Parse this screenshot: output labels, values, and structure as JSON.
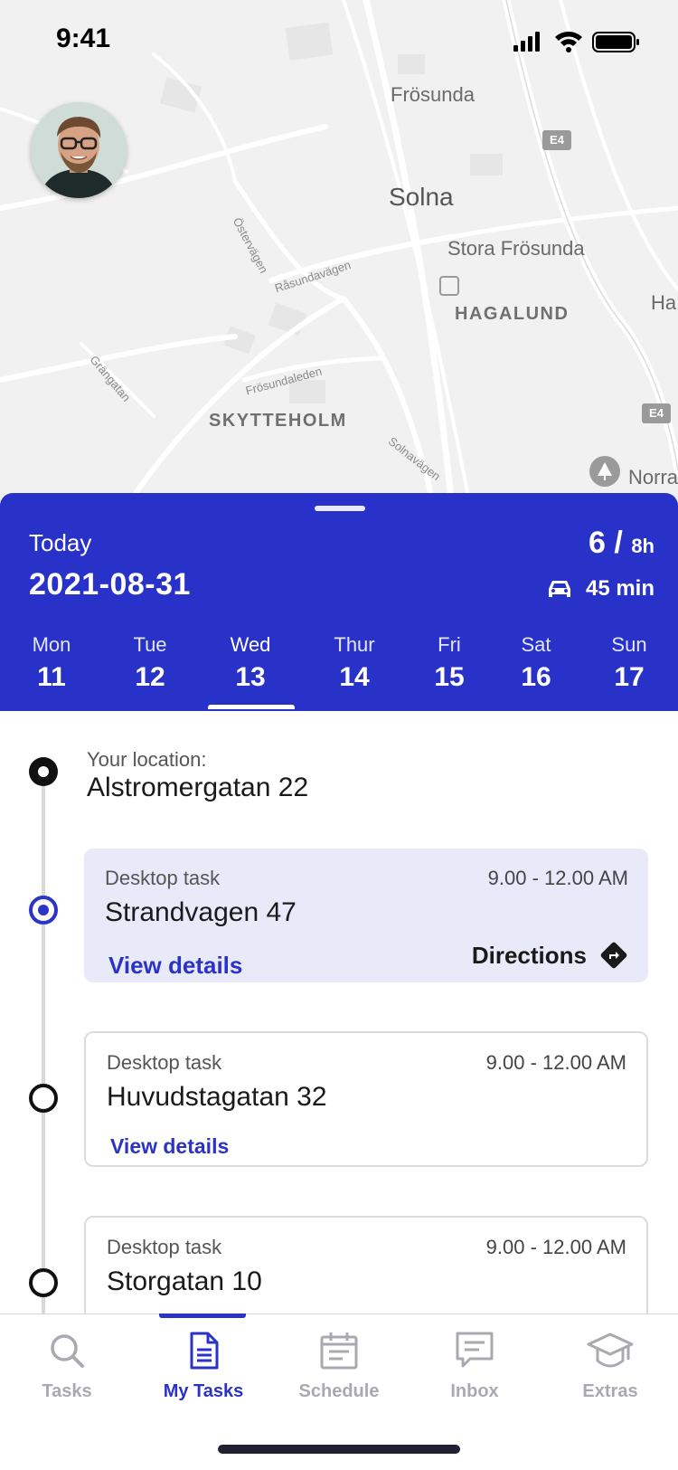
{
  "status_bar": {
    "time": "9:41"
  },
  "map": {
    "labels": {
      "frosunda": "Frösunda",
      "solna": "Solna",
      "stora_frosunda": "Stora Frösunda",
      "hagalund": "HAGALUND",
      "skytteholm": "SKYTTEHOLM",
      "ostervagen": "Östervägen",
      "rasundavagen": "Råsundavägen",
      "frosundaleden": "Frösundaleden",
      "grangatan": "Grängatan",
      "solnavagen": "Solnavägen",
      "ha": "Ha",
      "norra": "Norra",
      "e4_top": "E4",
      "e4_right": "E4"
    }
  },
  "schedule": {
    "today_label": "Today",
    "date": "2021-08-31",
    "hours_done": "6 /",
    "hours_total": "8h",
    "drive_time": "45 min",
    "days": [
      {
        "name": "Mon",
        "num": "11"
      },
      {
        "name": "Tue",
        "num": "12"
      },
      {
        "name": "Wed",
        "num": "13"
      },
      {
        "name": "Thur",
        "num": "14"
      },
      {
        "name": "Fri",
        "num": "15"
      },
      {
        "name": "Sat",
        "num": "16"
      },
      {
        "name": "Sun",
        "num": "17"
      }
    ],
    "selected_day": "Wed"
  },
  "location": {
    "label": "Your location:",
    "value": "Alstromergatan 22"
  },
  "tasks": [
    {
      "type": "Desktop task",
      "time": "9.00 - 12.00 AM",
      "address": "Strandvagen 47",
      "link": "View details",
      "directions": "Directions"
    },
    {
      "type": "Desktop task",
      "time": "9.00 - 12.00 AM",
      "address": "Huvudstagatan 32",
      "link": "View details"
    },
    {
      "type": "Desktop task",
      "time": "9.00 - 12.00 AM",
      "address": "Storgatan 10"
    }
  ],
  "tabbar": {
    "items": [
      {
        "label": "Tasks",
        "icon": "search-icon"
      },
      {
        "label": "My Tasks",
        "icon": "document-icon"
      },
      {
        "label": "Schedule",
        "icon": "calendar-icon"
      },
      {
        "label": "Inbox",
        "icon": "chat-icon"
      },
      {
        "label": "Extras",
        "icon": "graduation-cap-icon"
      }
    ],
    "active": "My Tasks"
  },
  "colors": {
    "accent": "#2832C9",
    "selected_task_bg": "#E8E9F9",
    "inactive_tab": "#A9AAB1"
  }
}
